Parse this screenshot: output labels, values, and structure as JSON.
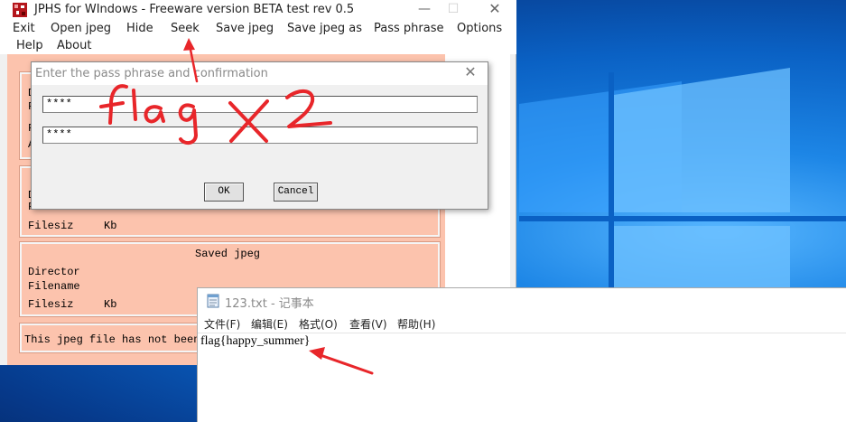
{
  "jphs": {
    "title": "JPHS for WIndows - Freeware version BETA test rev 0.5",
    "menu": [
      "Exit",
      "Open jpeg",
      "Hide",
      "Seek",
      "Save jpeg",
      "Save jpeg as",
      "Pass phrase",
      "Options",
      "Help",
      "About"
    ],
    "labels": {
      "filesize": "Filesiz",
      "kb": "Kb",
      "saved_jpeg": "Saved jpeg",
      "director": "Director",
      "filename": "Filename",
      "status": "This jpeg file has not been"
    },
    "partial_labels": {
      "group1_row1": "D",
      "group1_row2": "F",
      "group1_row3": "F",
      "group1_row4": "A",
      "group2_row1": "D",
      "group2_row2": "F"
    }
  },
  "dialog": {
    "title": "Enter the pass phrase and confirmation",
    "passphrase_value": "****",
    "confirmation_value": "****",
    "ok_label": "OK",
    "cancel_label": "Cancel"
  },
  "annotation": {
    "handwritten_text": "flag x 2"
  },
  "notepad": {
    "title": "123.txt - 记事本",
    "menu": [
      "文件(F)",
      "编辑(E)",
      "格式(O)",
      "查看(V)",
      "帮助(H)"
    ],
    "content": "flag{happy_summer}"
  },
  "colors": {
    "jphs_client": "#fcc3ad",
    "annotation": "#e8262a",
    "desktop": "#0a61c4"
  }
}
